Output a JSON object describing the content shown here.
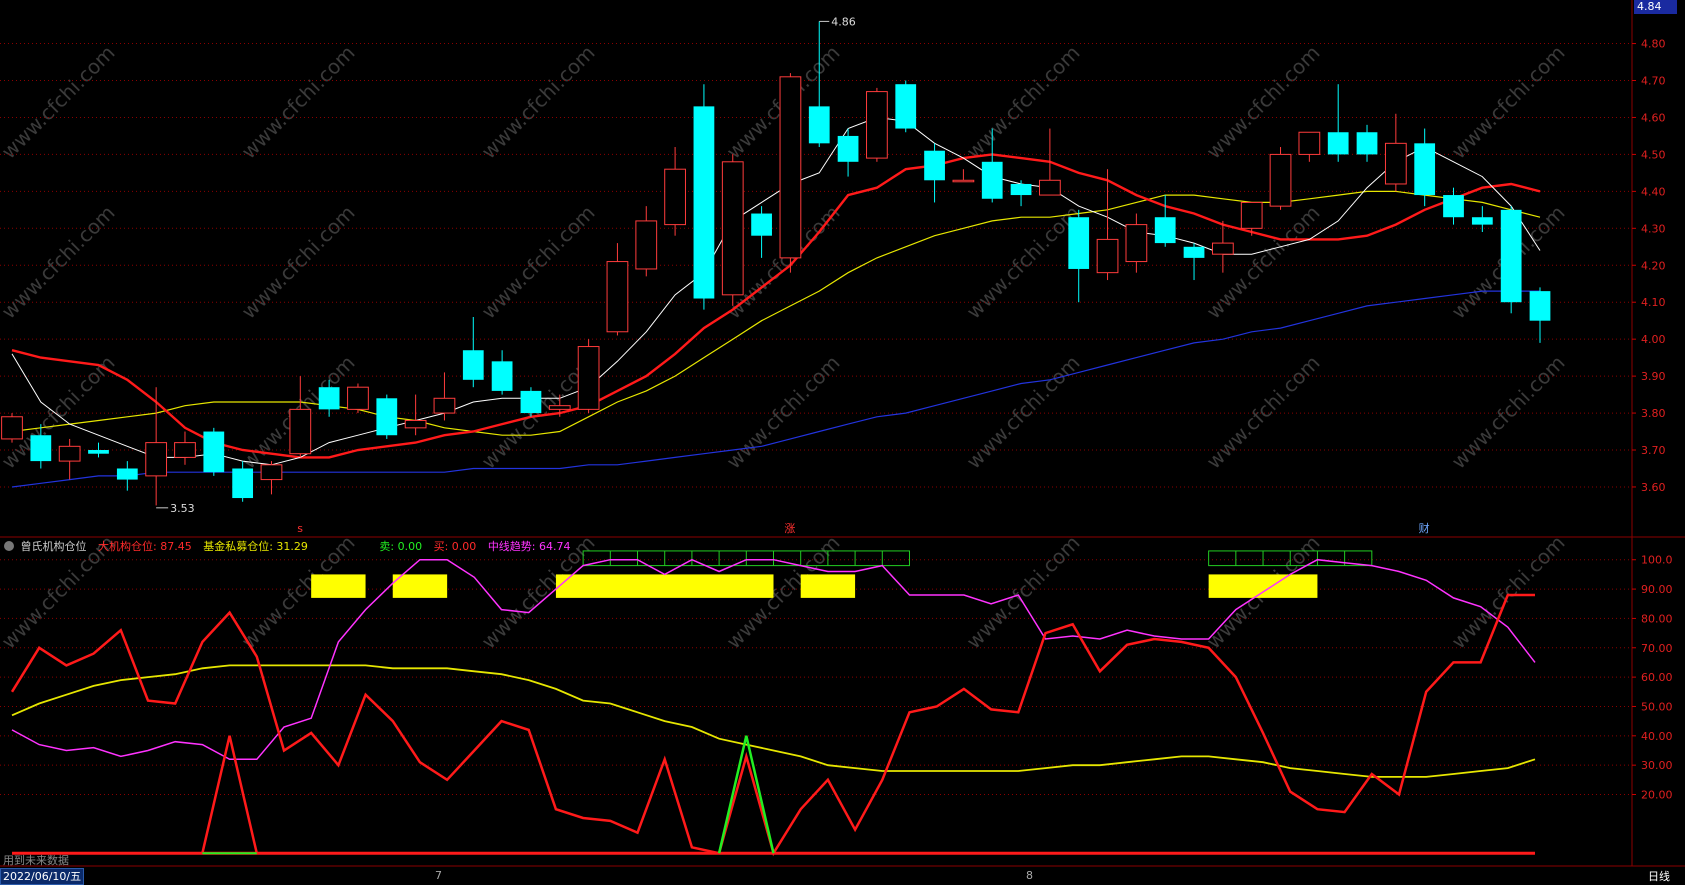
{
  "colors": {
    "bg": "#000000",
    "up": "#ff3c3c",
    "down": "#00ffff",
    "ma5": "#ffffff",
    "ma10": "#ff1a1a",
    "ma20": "#e6e600",
    "ma60": "#2233dd",
    "grid": "#8b0000"
  },
  "watermark": "www.cfchi.com",
  "top_right_price": "4.84",
  "bottom_status": {
    "date_box": "2022/06/10/五",
    "month_7": "7",
    "month_8": "8",
    "period": "日线",
    "future_note": "用到未来数据"
  },
  "markers": {
    "high": "4.86",
    "low": "3.53",
    "zhang": "涨",
    "cai": "财",
    "s": "s"
  },
  "indicator_header": {
    "name": "曾氏机构仓位",
    "big_inst_label": "大机构仓位: 87.45",
    "fund_label": "基金私募仓位: 31.29",
    "sell_label": "卖: 0.00",
    "buy_label": "买: 0.00",
    "mid_trend_label": "中线趋势: 64.74"
  },
  "chart_data": [
    {
      "type": "candlestick",
      "title": "",
      "y_axis_ticks": [
        "4.80",
        "4.70",
        "4.60",
        "4.50",
        "4.40",
        "4.30",
        "4.20",
        "4.10",
        "4.00",
        "3.90",
        "3.80",
        "3.70",
        "3.60"
      ],
      "ylim": [
        3.47,
        4.88
      ],
      "candles": [
        [
          3.73,
          3.79,
          3.72,
          3.8
        ],
        [
          3.74,
          3.67,
          3.65,
          3.77
        ],
        [
          3.67,
          3.71,
          3.62,
          3.73
        ],
        [
          3.7,
          3.69,
          3.68,
          3.72
        ],
        [
          3.65,
          3.62,
          3.59,
          3.67
        ],
        [
          3.63,
          3.72,
          3.55,
          3.87
        ],
        [
          3.68,
          3.72,
          3.66,
          3.75
        ],
        [
          3.75,
          3.64,
          3.63,
          3.76
        ],
        [
          3.65,
          3.57,
          3.56,
          3.67
        ],
        [
          3.62,
          3.66,
          3.58,
          3.67
        ],
        [
          3.69,
          3.81,
          3.68,
          3.9
        ],
        [
          3.87,
          3.81,
          3.79,
          3.89
        ],
        [
          3.81,
          3.87,
          3.8,
          3.88
        ],
        [
          3.84,
          3.74,
          3.73,
          3.85
        ],
        [
          3.76,
          3.78,
          3.74,
          3.85
        ],
        [
          3.8,
          3.84,
          3.78,
          3.91
        ],
        [
          3.97,
          3.89,
          3.87,
          4.06
        ],
        [
          3.94,
          3.86,
          3.85,
          3.97
        ],
        [
          3.86,
          3.8,
          3.79,
          3.87
        ],
        [
          3.81,
          3.82,
          3.79,
          3.85
        ],
        [
          3.81,
          3.98,
          3.8,
          4.0
        ],
        [
          4.02,
          4.21,
          4.01,
          4.26
        ],
        [
          4.19,
          4.32,
          4.17,
          4.36
        ],
        [
          4.31,
          4.46,
          4.28,
          4.52
        ],
        [
          4.63,
          4.11,
          4.08,
          4.69
        ],
        [
          4.12,
          4.48,
          4.09,
          4.5
        ],
        [
          4.34,
          4.28,
          4.22,
          4.36
        ],
        [
          4.22,
          4.71,
          4.18,
          4.72
        ],
        [
          4.63,
          4.53,
          4.52,
          4.86
        ],
        [
          4.55,
          4.48,
          4.44,
          4.57
        ],
        [
          4.49,
          4.67,
          4.48,
          4.68
        ],
        [
          4.69,
          4.57,
          4.56,
          4.7
        ],
        [
          4.51,
          4.43,
          4.37,
          4.53
        ],
        [
          4.43,
          4.43,
          4.43,
          4.46
        ],
        [
          4.48,
          4.38,
          4.37,
          4.57
        ],
        [
          4.42,
          4.39,
          4.36,
          4.43
        ],
        [
          4.39,
          4.43,
          4.39,
          4.57
        ],
        [
          4.33,
          4.19,
          4.1,
          4.35
        ],
        [
          4.18,
          4.27,
          4.16,
          4.46
        ],
        [
          4.21,
          4.31,
          4.18,
          4.34
        ],
        [
          4.33,
          4.26,
          4.25,
          4.39
        ],
        [
          4.25,
          4.22,
          4.16,
          4.26
        ],
        [
          4.23,
          4.26,
          4.18,
          4.32
        ],
        [
          4.3,
          4.37,
          4.28,
          4.37
        ],
        [
          4.36,
          4.5,
          4.35,
          4.52
        ],
        [
          4.5,
          4.56,
          4.48,
          4.56
        ],
        [
          4.56,
          4.5,
          4.48,
          4.69
        ],
        [
          4.56,
          4.5,
          4.48,
          4.58
        ],
        [
          4.42,
          4.53,
          4.4,
          4.61
        ],
        [
          4.53,
          4.39,
          4.36,
          4.57
        ],
        [
          4.39,
          4.33,
          4.31,
          4.41
        ],
        [
          4.33,
          4.31,
          4.29,
          4.36
        ],
        [
          4.35,
          4.1,
          4.07,
          4.36
        ],
        [
          4.13,
          4.05,
          3.99,
          4.14
        ]
      ],
      "ma5": [
        3.96,
        3.83,
        3.77,
        3.74,
        3.71,
        3.68,
        3.68,
        3.69,
        3.67,
        3.66,
        3.68,
        3.72,
        3.74,
        3.76,
        3.78,
        3.8,
        3.83,
        3.84,
        3.84,
        3.84,
        3.87,
        3.94,
        4.02,
        4.12,
        4.18,
        4.32,
        4.37,
        4.42,
        4.45,
        4.57,
        4.6,
        4.59,
        4.53,
        4.49,
        4.44,
        4.42,
        4.41,
        4.36,
        4.33,
        4.29,
        4.28,
        4.26,
        4.23,
        4.23,
        4.25,
        4.27,
        4.32,
        4.41,
        4.48,
        4.52,
        4.48,
        4.44,
        4.36,
        4.24
      ],
      "ma10": [
        3.97,
        3.95,
        3.94,
        3.93,
        3.89,
        3.83,
        3.76,
        3.72,
        3.7,
        3.69,
        3.68,
        3.68,
        3.7,
        3.71,
        3.72,
        3.74,
        3.75,
        3.77,
        3.79,
        3.8,
        3.82,
        3.86,
        3.9,
        3.96,
        4.03,
        4.08,
        4.14,
        4.2,
        4.29,
        4.39,
        4.41,
        4.46,
        4.47,
        4.49,
        4.5,
        4.49,
        4.48,
        4.45,
        4.43,
        4.39,
        4.36,
        4.34,
        4.31,
        4.29,
        4.27,
        4.27,
        4.27,
        4.28,
        4.31,
        4.35,
        4.38,
        4.41,
        4.42,
        4.4
      ],
      "ma20": [
        3.75,
        3.76,
        3.77,
        3.78,
        3.79,
        3.8,
        3.82,
        3.83,
        3.83,
        3.83,
        3.83,
        3.82,
        3.81,
        3.79,
        3.78,
        3.76,
        3.75,
        3.74,
        3.74,
        3.75,
        3.79,
        3.83,
        3.86,
        3.9,
        3.95,
        4.0,
        4.05,
        4.09,
        4.13,
        4.18,
        4.22,
        4.25,
        4.28,
        4.3,
        4.32,
        4.33,
        4.33,
        4.34,
        4.35,
        4.37,
        4.39,
        4.39,
        4.38,
        4.37,
        4.37,
        4.38,
        4.39,
        4.4,
        4.4,
        4.39,
        4.38,
        4.37,
        4.35,
        4.33
      ],
      "ma60": [
        3.6,
        3.61,
        3.62,
        3.63,
        3.63,
        3.64,
        3.64,
        3.64,
        3.64,
        3.64,
        3.64,
        3.64,
        3.64,
        3.64,
        3.64,
        3.64,
        3.65,
        3.65,
        3.65,
        3.65,
        3.66,
        3.66,
        3.67,
        3.68,
        3.69,
        3.7,
        3.71,
        3.73,
        3.75,
        3.77,
        3.79,
        3.8,
        3.82,
        3.84,
        3.86,
        3.88,
        3.89,
        3.91,
        3.93,
        3.95,
        3.97,
        3.99,
        4.0,
        4.02,
        4.03,
        4.05,
        4.07,
        4.09,
        4.1,
        4.11,
        4.12,
        4.13,
        4.13,
        4.13
      ]
    },
    {
      "type": "line",
      "title": "曾氏机构仓位",
      "y_axis_ticks": [
        "100.0",
        "90.00",
        "80.00",
        "70.00",
        "60.00",
        "50.00",
        "40.00",
        "30.00",
        "20.00"
      ],
      "ylim": [
        -3,
        104
      ],
      "series": [
        {
          "name": "大机构仓位",
          "color": "#ff1a1a",
          "values": [
            55,
            70,
            64,
            68,
            76,
            52,
            51,
            72,
            82,
            67,
            35,
            41,
            30,
            54,
            45,
            31,
            25,
            35,
            45,
            42,
            15,
            12,
            11,
            7,
            32,
            2,
            0,
            33,
            0,
            15,
            25,
            8,
            25,
            48,
            50,
            56,
            49,
            48,
            75,
            78,
            62,
            71,
            73,
            72,
            70,
            60,
            41,
            21,
            15,
            14,
            27,
            20,
            55,
            65,
            65,
            88,
            88
          ]
        },
        {
          "name": "基金私募仓位",
          "color": "#e6e600",
          "values": [
            47,
            51,
            54,
            57,
            59,
            60,
            61,
            63,
            64,
            64,
            64,
            64,
            64,
            64,
            63,
            63,
            63,
            62,
            61,
            59,
            56,
            52,
            51,
            48,
            45,
            43,
            39,
            37,
            35,
            33,
            30,
            29,
            28,
            28,
            28,
            28,
            28,
            28,
            29,
            30,
            30,
            31,
            32,
            33,
            33,
            32,
            31,
            29,
            28,
            27,
            26,
            26,
            26,
            27,
            28,
            29,
            32
          ]
        },
        {
          "name": "中线趋势",
          "color": "#ff33ff",
          "values": [
            42,
            37,
            35,
            36,
            33,
            35,
            38,
            37,
            32,
            32,
            43,
            46,
            72,
            83,
            92,
            100,
            100,
            94,
            83,
            82,
            90,
            98,
            100,
            100,
            95,
            100,
            96,
            100,
            100,
            98,
            96,
            96,
            98,
            88,
            88,
            88,
            85,
            88,
            73,
            74,
            73,
            76,
            74,
            73,
            73,
            83,
            89,
            95,
            100,
            99,
            98,
            96,
            93,
            87,
            84,
            77,
            65
          ]
        },
        {
          "name": "卖",
          "color": "#22ee22",
          "values": [
            0,
            0,
            0,
            0,
            0,
            0,
            0,
            0,
            0,
            0,
            0,
            0,
            0,
            0,
            0,
            0,
            0,
            0,
            0,
            0,
            0,
            0,
            0,
            0,
            0,
            0,
            0,
            0,
            0,
            0,
            0,
            0,
            0,
            0,
            0,
            0,
            0,
            0,
            0,
            0,
            0,
            0,
            0,
            0,
            0,
            0,
            0,
            0,
            0,
            0,
            0,
            0,
            0,
            0,
            0,
            0,
            0
          ]
        },
        {
          "name": "买",
          "color": "#ff1a1a",
          "values": [
            0,
            0,
            0,
            0,
            0,
            0,
            0,
            0,
            0,
            0,
            0,
            0,
            0,
            0,
            0,
            0,
            0,
            0,
            0,
            0,
            0,
            0,
            0,
            0,
            0,
            0,
            0,
            0,
            0,
            0,
            0,
            0,
            0,
            0,
            0,
            0,
            0,
            0,
            0,
            0,
            0,
            0,
            0,
            0,
            0,
            0,
            0,
            0,
            0,
            0,
            0,
            0,
            0,
            0,
            0,
            0,
            0
          ]
        }
      ],
      "yellow_bars": [
        [
          11,
          13
        ],
        [
          14,
          16
        ],
        [
          20,
          28
        ],
        [
          29,
          31
        ],
        [
          44,
          48
        ]
      ],
      "green_boxes": [
        [
          21,
          33
        ],
        [
          44,
          50
        ]
      ],
      "red_spike_at": 8,
      "green_spike_at": 27
    }
  ]
}
